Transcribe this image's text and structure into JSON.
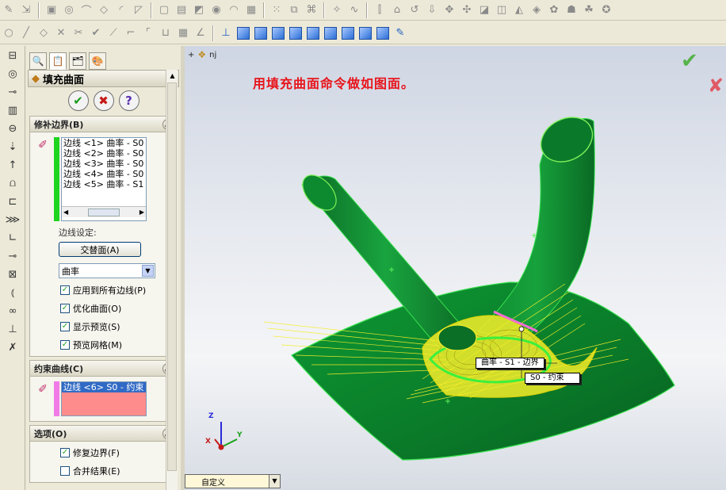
{
  "panel": {
    "title": "填充曲面",
    "help_mark": "?",
    "confirm": {
      "ok": "✔",
      "cancel": "✖",
      "help": "?"
    },
    "patch_boundary": {
      "header": "修补边界(B)",
      "items": [
        "边线 <1> 曲率 - S0 -",
        "边线 <2> 曲率 - S0 -",
        "边线 <3> 曲率 - S0 -",
        "边线 <4> 曲率 - S0 -",
        "边线 <5> 曲率 - S1 -"
      ],
      "edge_settings_label": "边线设定:",
      "alternate_face_button": "交替面(A)",
      "curvature_select": "曲率",
      "checkboxes": [
        {
          "label": "应用到所有边线(P)",
          "checked": true
        },
        {
          "label": "优化曲面(O)",
          "checked": true
        },
        {
          "label": "显示预览(S)",
          "checked": true
        },
        {
          "label": "预览网格(M)",
          "checked": true
        }
      ]
    },
    "constraint_curves": {
      "header": "约束曲线(C)",
      "items": [
        "边线 <6> S0 - 约束"
      ]
    },
    "options": {
      "header": "选项(O)",
      "checkboxes": [
        {
          "label": "修复边界(F)",
          "checked": true
        },
        {
          "label": "合并结果(E)",
          "checked": false
        }
      ]
    }
  },
  "viewport": {
    "tree_label": "nj",
    "caption": "用填充曲面命令做如图面。",
    "callouts": [
      "曲率 - S1 - 边界",
      "S0 - 约束"
    ],
    "axes": {
      "x": "X",
      "y": "Y",
      "z": "Z"
    },
    "view_combo": "自定义"
  },
  "colors": {
    "surface_green": "#0e8a2c",
    "preview_yellow": "#f4ee2a",
    "caption_red": "#e8141b"
  }
}
